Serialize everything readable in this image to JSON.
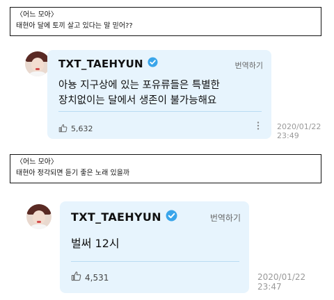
{
  "colors": {
    "card_bg": "#e7f4fd",
    "verified_blue": "#3aa5ea",
    "timestamp_gray": "#999999"
  },
  "questions": [
    {
      "title": "〈어느 모아〉",
      "text": "태현아 달에 토끼 살고 있다는 말 믿어??"
    },
    {
      "title": "〈어느 모아〉",
      "text": "태현아 정각되면 듣기 좋은 노래 있을까"
    }
  ],
  "replies": [
    {
      "handle": "TXT_TAEHYUN",
      "translate_label": "번역하기",
      "text_line1": "아뇽 지구상에 있는 포유류들은 특별한",
      "text_line2": "장치없이는 달에서 생존이 불가능해요",
      "likes": "5,632",
      "date": "2020/01/22",
      "time": "23:49",
      "icons": [
        "avatar",
        "verified-badge-icon",
        "thumbs-up-icon",
        "more-vertical-icon"
      ]
    },
    {
      "handle": "TXT_TAEHYUN",
      "translate_label": "번역하기",
      "text": "벌써 12시",
      "likes": "4,531",
      "date": "2020/01/22",
      "time": "23:47",
      "icons": [
        "avatar",
        "verified-badge-icon",
        "thumbs-up-icon"
      ]
    }
  ]
}
